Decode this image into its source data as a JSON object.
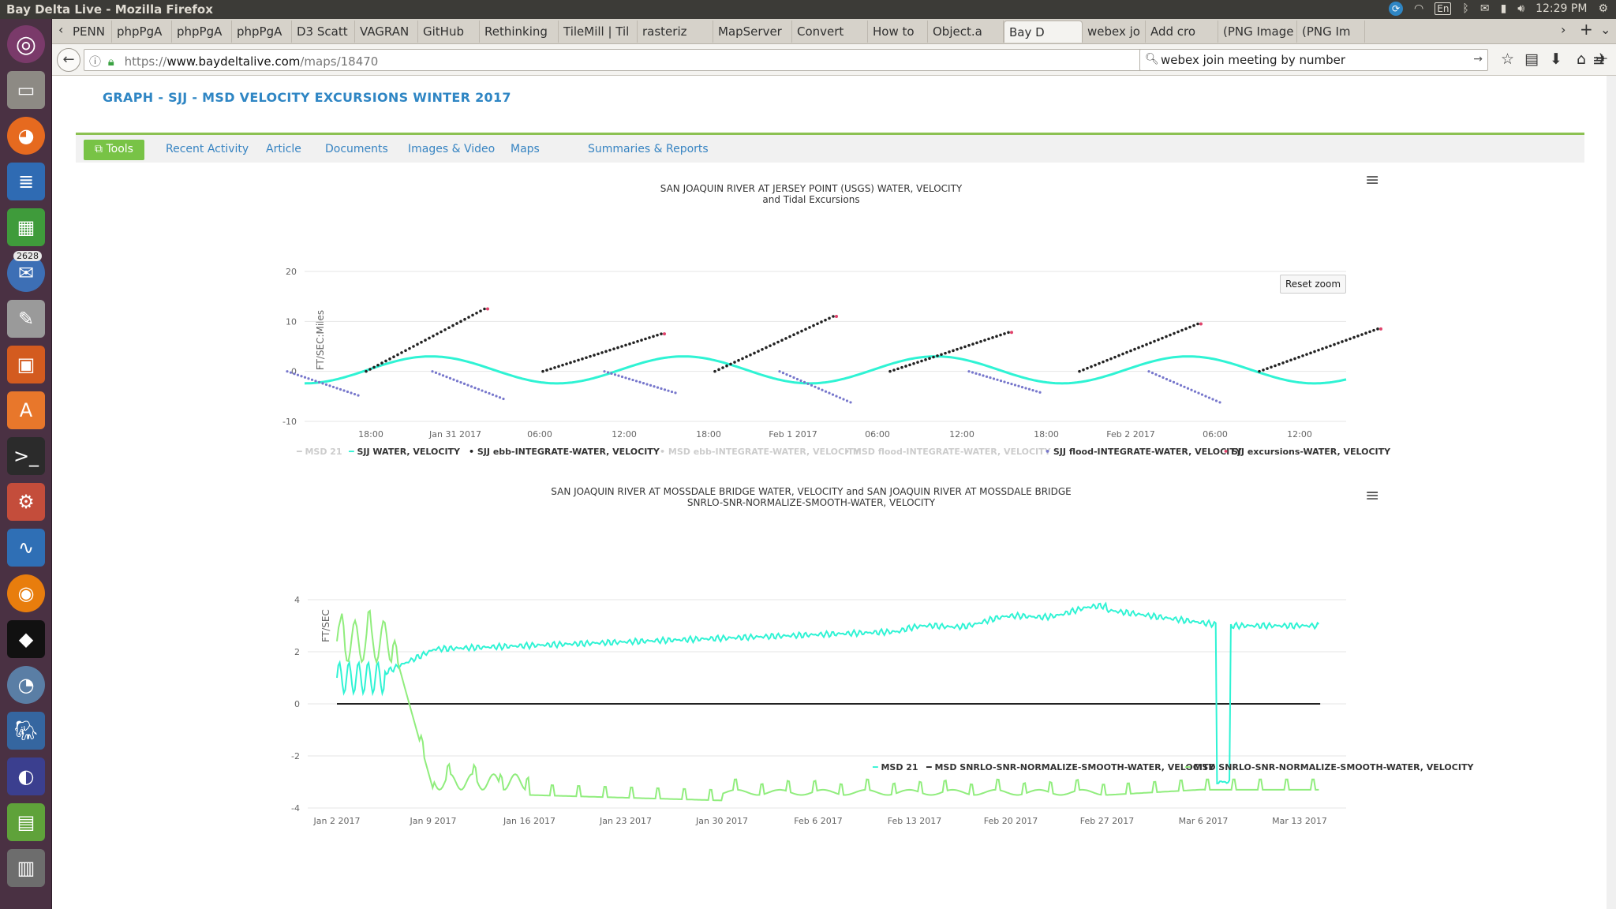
{
  "os": {
    "window_title": "Bay Delta Live - Mozilla Firefox",
    "keyboard": "En",
    "clock": "12:29 PM",
    "launcher_badge": "2628"
  },
  "browser": {
    "tabs": [
      {
        "label": "PENN"
      },
      {
        "label": "phpPgA"
      },
      {
        "label": "phpPgA"
      },
      {
        "label": "phpPgA"
      },
      {
        "label": "D3 Scatt"
      },
      {
        "label": "VAGRAN"
      },
      {
        "label": "GitHub"
      },
      {
        "label": "Rethinking"
      },
      {
        "label": "TileMill | Til"
      },
      {
        "label": "rasteriz"
      },
      {
        "label": "MapServer"
      },
      {
        "label": "Convert"
      },
      {
        "label": "How to"
      },
      {
        "label": "Object.a"
      },
      {
        "label": "Bay D"
      },
      {
        "label": "webex jo"
      },
      {
        "label": "Add cro"
      },
      {
        "label": "(PNG Image"
      },
      {
        "label": "(PNG Im"
      }
    ],
    "url_host": "www.baydeltalive.com",
    "url_prefix": "https://",
    "url_path": "/maps/18470",
    "search_value": "webex join meeting by number"
  },
  "page": {
    "title": "GRAPH - SJJ - MSD VELOCITY EXCURSIONS WINTER 2017",
    "nav": {
      "tools": "Tools",
      "items": [
        "Recent Activity",
        "Article",
        "Documents",
        "Images & Video",
        "Maps",
        "Summaries & Reports"
      ]
    }
  },
  "chart_data": [
    {
      "type": "line",
      "title": "SAN JOAQUIN RIVER AT JERSEY POINT (USGS) WATER, VELOCITY",
      "subtitle": "and Tidal Excursions",
      "ylabel": "FT/SEC:Miles",
      "ylim": [
        -10,
        20
      ],
      "yticks": [
        "20",
        "10",
        "0",
        "-10"
      ],
      "xticks": [
        "18:00",
        "Jan 31 2017",
        "06:00",
        "12:00",
        "18:00",
        "Feb 1 2017",
        "06:00",
        "12:00",
        "18:00",
        "Feb 2 2017",
        "06:00",
        "12:00"
      ],
      "reset_zoom": "Reset zoom",
      "legend": [
        {
          "name": "MSD 21",
          "visible": false,
          "color": "#cccccc"
        },
        {
          "name": "SJJ WATER, VELOCITY",
          "visible": true,
          "color": "#2ff3d4"
        },
        {
          "name": "SJJ ebb-INTEGRATE-WATER, VELOCITY",
          "visible": true,
          "color": "#222222"
        },
        {
          "name": "MSD ebb-INTEGRATE-WATER, VELOCITY",
          "visible": false,
          "color": "#cccccc"
        },
        {
          "name": "MSD flood-INTEGRATE-WATER, VELOCITY",
          "visible": false,
          "color": "#cccccc"
        },
        {
          "name": "SJJ flood-INTEGRATE-WATER, VELOCITY",
          "visible": true,
          "color": "#7777cc"
        },
        {
          "name": "SJJ excursions-WATER, VELOCITY",
          "visible": true,
          "color": "#e0436b"
        }
      ],
      "series": [
        {
          "name": "SJJ WATER, VELOCITY",
          "approx": "semi-diurnal tidal velocity oscillating between about -2.5 and 3 ft/sec"
        },
        {
          "name": "SJJ ebb-INTEGRATE-WATER, VELOCITY",
          "peaks": [
            12.5,
            7.5,
            11,
            7.8,
            9.5,
            8.5
          ]
        },
        {
          "name": "SJJ flood-INTEGRATE-WATER, VELOCITY",
          "troughs": [
            -4.8,
            -5.5,
            -4.3,
            -6.2,
            -4.2,
            -6.2
          ]
        }
      ]
    },
    {
      "type": "line",
      "title": "SAN JOAQUIN RIVER AT MOSSDALE BRIDGE WATER, VELOCITY and SAN JOAQUIN RIVER AT MOSSDALE BRIDGE",
      "subtitle": "SNRLO-SNR-NORMALIZE-SMOOTH-WATER, VELOCITY",
      "ylabel": "FT/SEC",
      "ylim": [
        -4,
        4
      ],
      "yticks": [
        "4",
        "2",
        "0",
        "-2",
        "-4"
      ],
      "xticks": [
        "Jan 2 2017",
        "Jan 9 2017",
        "Jan 16 2017",
        "Jan 23 2017",
        "Jan 30 2017",
        "Feb 6 2017",
        "Feb 13 2017",
        "Feb 20 2017",
        "Feb 27 2017",
        "Mar 6 2017",
        "Mar 13 2017"
      ],
      "legend": [
        {
          "name": "MSD 21",
          "visible": true,
          "color": "#2ff3d4"
        },
        {
          "name": "MSD SNRLO-SNR-NORMALIZE-SMOOTH-WATER, VELOCITY",
          "visible": true,
          "color": "#222222"
        },
        {
          "name": "MSD SNRLO-SNR-NORMALIZE-SMOOTH-WATER, VELOCITY",
          "visible": true,
          "color": "#90ed7d"
        }
      ],
      "series": [
        {
          "name": "MSD 21",
          "x": [
            "Jan 2",
            "Jan 5",
            "Jan 9",
            "Jan 16",
            "Jan 23",
            "Jan 30",
            "Feb 6",
            "Feb 13",
            "Feb 20",
            "Feb 27",
            "Mar 6",
            "Mar 9",
            "Mar 13",
            "Mar 14"
          ],
          "values": [
            1.0,
            1.5,
            2.1,
            2.5,
            2.6,
            2.8,
            2.7,
            3.4,
            3.6,
            3.6,
            3.0,
            3.0,
            3.0,
            3.0
          ]
        },
        {
          "name": "MSD SNRLO-SNR-NORMALIZE-SMOOTH-WATER, VELOCITY",
          "x": [
            "Jan 2",
            "Mar 14"
          ],
          "values": [
            0,
            0
          ]
        },
        {
          "name": "MSD SNRLO-SNR-NORMALIZE-SMOOTH-WATER, VELOCITY",
          "x": [
            "Jan 2",
            "Jan 5",
            "Jan 9",
            "Jan 16",
            "Jan 23",
            "Jan 30",
            "Feb 6",
            "Feb 13",
            "Feb 20",
            "Feb 27",
            "Mar 6",
            "Mar 9",
            "Mar 13",
            "Mar 14"
          ],
          "values": [
            3.0,
            0.0,
            -3.0,
            -3.5,
            -3.7,
            -3.4,
            -3.3,
            -3.3,
            -3.5,
            -3.5,
            -3.4,
            -3.3,
            -3.3,
            -3.3
          ]
        }
      ]
    }
  ]
}
